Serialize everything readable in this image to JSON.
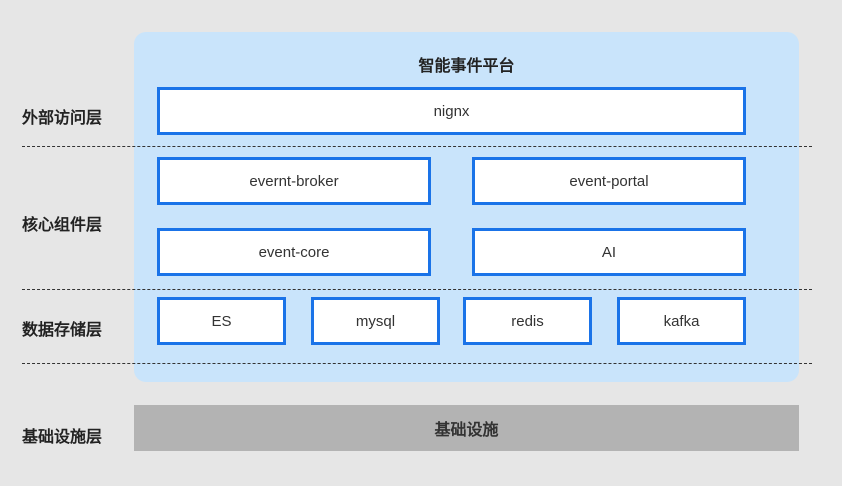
{
  "platform": {
    "title": "智能事件平台"
  },
  "layers": {
    "external": "外部访问层",
    "core": "核心组件层",
    "storage": "数据存储层",
    "infra": "基础设施层"
  },
  "components": {
    "nginx": "nignx",
    "broker": "evernt-broker",
    "portal": "event-portal",
    "core": "event-core",
    "ai": "AI",
    "es": "ES",
    "mysql": "mysql",
    "redis": "redis",
    "kafka": "kafka"
  },
  "infrastructure": {
    "label": "基础设施"
  },
  "colors": {
    "background": "#e6e6e6",
    "platform_fill": "#c9e4fb",
    "box_border": "#1a73e8",
    "infra_fill": "#b3b3b3"
  }
}
